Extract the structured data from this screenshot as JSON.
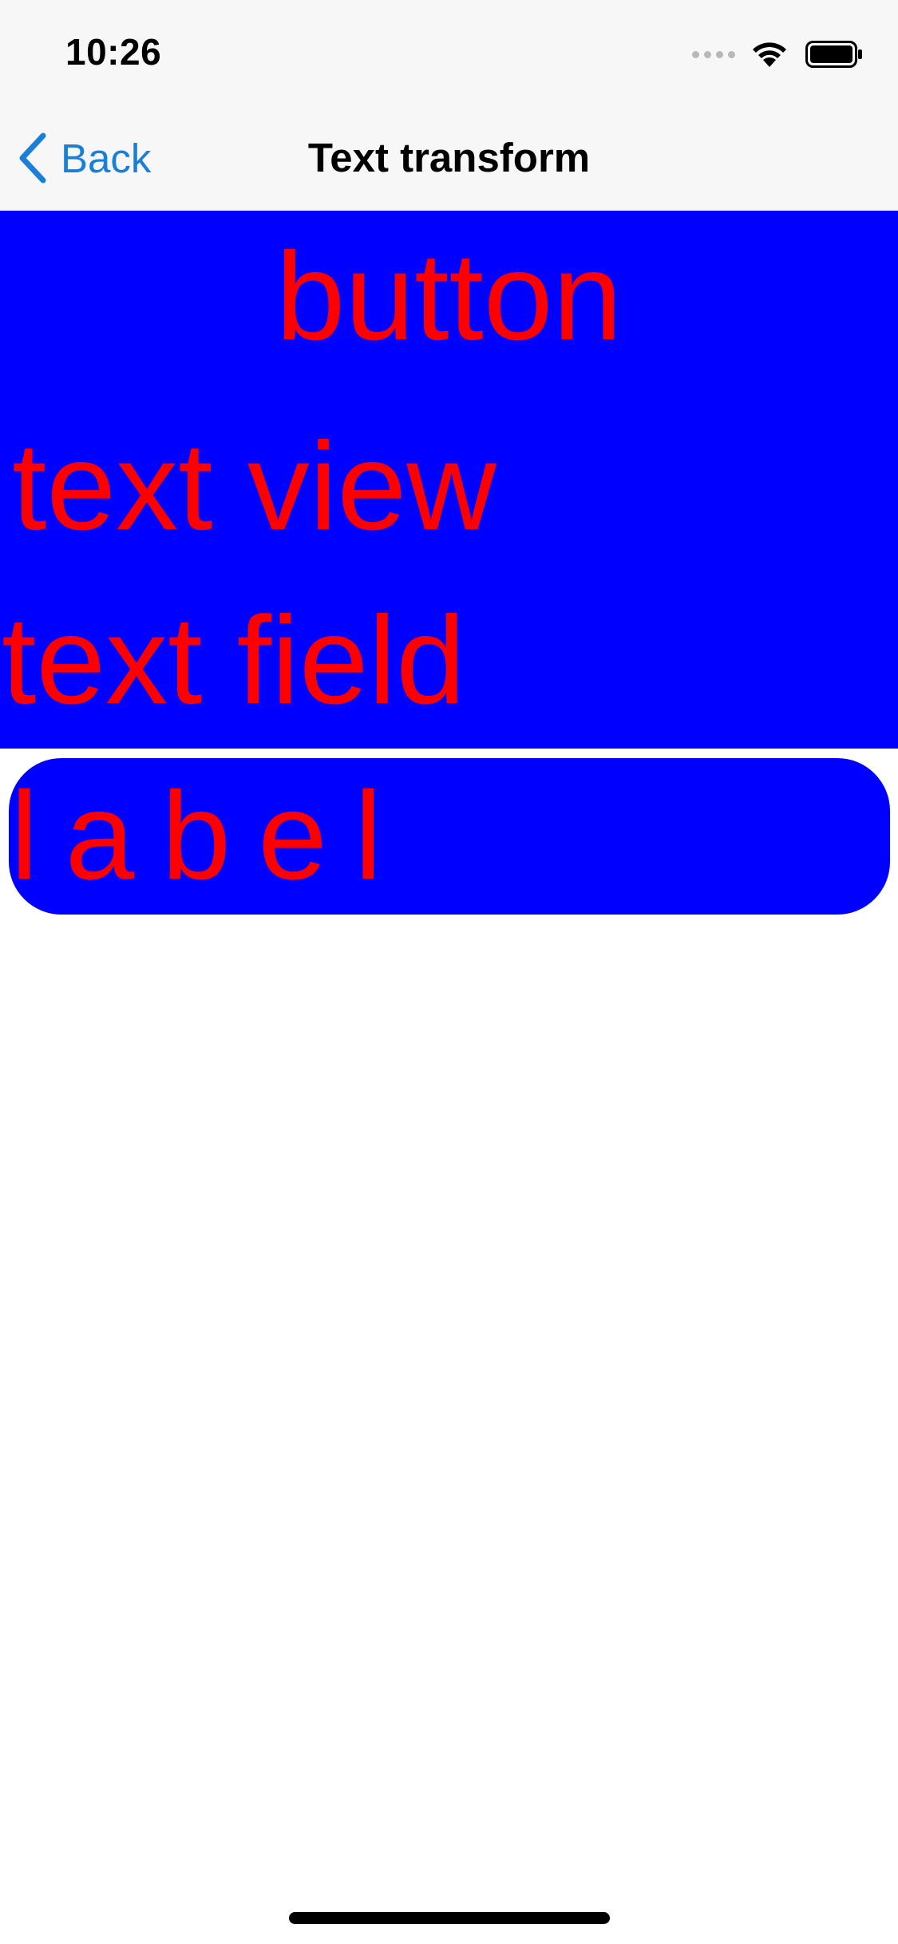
{
  "status_bar": {
    "time": "10:26",
    "icons": [
      "cellular-signal-icon",
      "wifi-icon",
      "battery-icon"
    ]
  },
  "nav_bar": {
    "back_label": "Back",
    "title": "Text transform",
    "back_icon": "chevron-left-icon"
  },
  "content": {
    "button_text": "button",
    "text_view_text": "text view",
    "text_field_value": "text field",
    "label_text": "label"
  },
  "colors": {
    "background_blue": "#0000ff",
    "text_red": "#ff0000",
    "accent": "#1a7fd7",
    "bar_background": "#f7f7f7"
  }
}
